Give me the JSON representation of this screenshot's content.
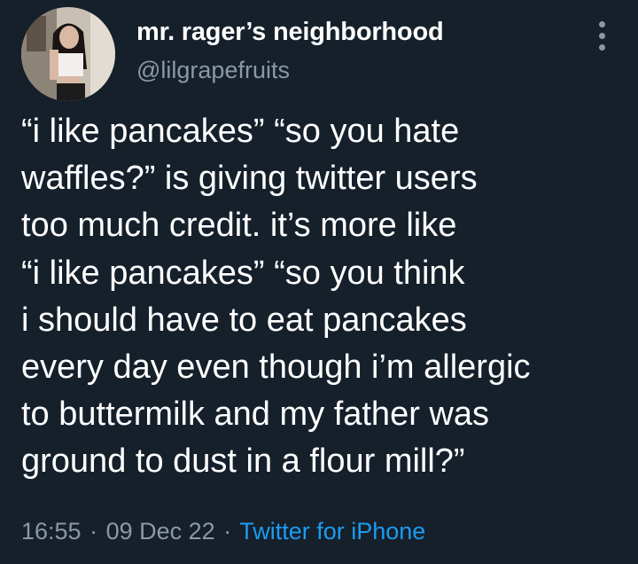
{
  "author": {
    "display_name": "mr. rager’s neighborhood",
    "handle": "@lilgrapefruits",
    "avatar_icon": "profile-photo"
  },
  "more_icon": "more-options-icon",
  "tweet": {
    "lines": [
      "“i like pancakes” “so you hate",
      "waffles?” is giving twitter users",
      "too much credit. it’s more like",
      "“i like pancakes” “so you think",
      "i should have to eat pancakes",
      "every day even though i’m allergic",
      "to buttermilk and my father was",
      "ground to dust in a flour mill?”"
    ]
  },
  "meta": {
    "time": "16:55",
    "separator": "·",
    "date": "09 Dec 22",
    "source": "Twitter for iPhone"
  },
  "colors": {
    "background": "#15202b",
    "primary_text": "#ffffff",
    "secondary_text": "#8b98a5",
    "link": "#1d9bf0"
  }
}
